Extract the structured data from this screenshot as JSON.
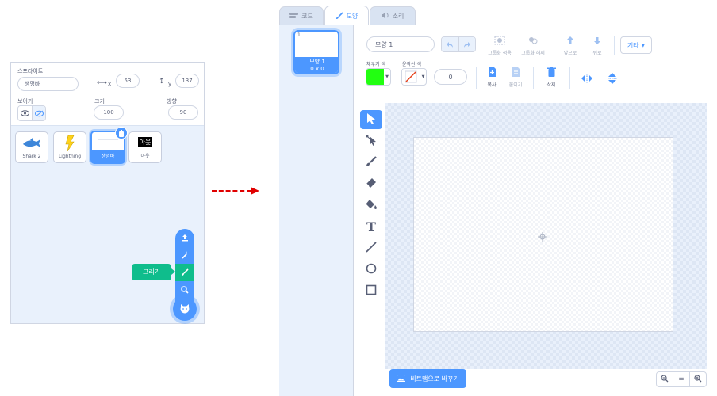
{
  "sprite_panel": {
    "sprite_label": "스프라이트",
    "sprite_name": "생명바",
    "x_label": "x",
    "x_value": "53",
    "y_label": "y",
    "y_value": "137",
    "show_label": "보이기",
    "size_label": "크기",
    "size_value": "100",
    "direction_label": "방향",
    "direction_value": "90",
    "sprites": [
      {
        "name": "Shark 2",
        "icon": "shark-icon"
      },
      {
        "name": "Lightning",
        "icon": "lightning-icon"
      },
      {
        "name": "생명바",
        "icon": "blank-bar-icon",
        "selected": true
      },
      {
        "name": "아웃",
        "icon": "out-text-icon",
        "thumb_text": "아웃"
      }
    ],
    "tooltip": "그리기",
    "fab_icons": [
      "upload-icon",
      "surprise-icon",
      "paint-brush-icon",
      "search-icon",
      "cat-add-icon"
    ]
  },
  "editor": {
    "tabs": [
      {
        "label": "코드",
        "icon": "code-icon"
      },
      {
        "label": "모양",
        "icon": "brush-icon",
        "active": true
      },
      {
        "label": "소리",
        "icon": "speaker-icon"
      }
    ],
    "costume": {
      "index": "1",
      "name": "모양 1",
      "size": "0 x 0"
    },
    "costume_name_value": "모양 1",
    "group_label": "그룹화 적용",
    "ungroup_label": "그룹화 해제",
    "forward_label": "앞으로",
    "backward_label": "뒤로",
    "more_label": "기타",
    "fill_label": "채우기 색",
    "outline_label": "윤곽선 색",
    "outline_width": "0",
    "copy_label": "복사",
    "paste_label": "붙이기",
    "delete_label": "삭제",
    "fill_color": "#22ff11",
    "convert_bitmap_label": "비트맵으로 바꾸기",
    "zoom_reset_label": "="
  },
  "colors": {
    "accent": "#4c97ff",
    "green": "#0fbd8c",
    "arrow": "#e00000"
  }
}
